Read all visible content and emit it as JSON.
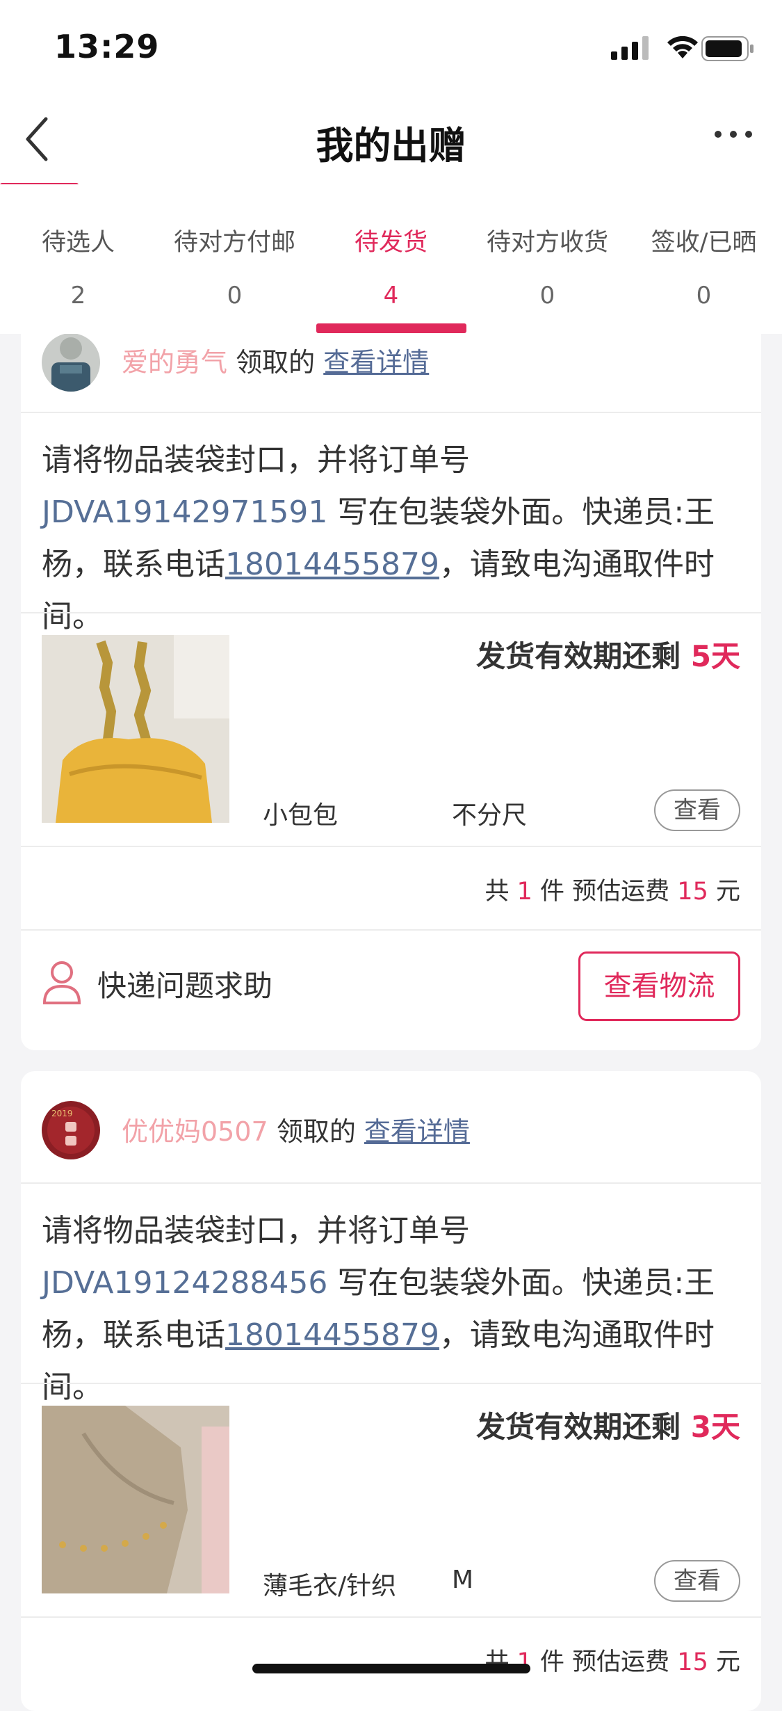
{
  "status_bar": {
    "time": "13:29"
  },
  "nav": {
    "title": "我的出赠"
  },
  "tabs": [
    {
      "label": "待选人",
      "count": "2"
    },
    {
      "label": "待对方付邮",
      "count": "0"
    },
    {
      "label": "待发货",
      "count": "4"
    },
    {
      "label": "待对方收货",
      "count": "0"
    },
    {
      "label": "签收/已晒",
      "count": "0"
    }
  ],
  "active_tab": 2,
  "orders": [
    {
      "user_name": "爱的勇气",
      "claim_text": "领取的",
      "detail_link": "查看详情",
      "instr_pre": "请将物品装袋封口，并将订单号 ",
      "order_no": "JDVA19142971591",
      "instr_mid": " 写在包装袋外面。快递员:王杨，联系电话",
      "phone": "18014455879",
      "instr_post": "，请致电沟通取件时间。",
      "deadline_label": "发货有效期还剩",
      "deadline_days": "5天",
      "item_name": "小包包",
      "item_size": "不分尺",
      "view_label": "查看",
      "summary_pre": "共",
      "summary_count": "1",
      "summary_mid": "件 预估运费",
      "summary_fee": "15",
      "summary_unit": "元",
      "help_label": "快递问题求助",
      "logistics_label": "查看物流"
    },
    {
      "user_name": "优优妈0507",
      "claim_text": "领取的",
      "detail_link": "查看详情",
      "instr_pre": "请将物品装袋封口，并将订单号 ",
      "order_no": "JDVA19124288456",
      "instr_mid": " 写在包装袋外面。快递员:王杨，联系电话",
      "phone": "18014455879",
      "instr_post": "，请致电沟通取件时间。",
      "deadline_label": "发货有效期还剩",
      "deadline_days": "3天",
      "item_name": "薄毛衣/针织",
      "item_size": "M",
      "view_label": "查看",
      "summary_pre": "共",
      "summary_count": "1",
      "summary_mid": "件 预估运费",
      "summary_fee": "15",
      "summary_unit": "元"
    }
  ],
  "colors": {
    "accent": "#e0295b",
    "link": "#566f96",
    "username": "#f2a2a8"
  }
}
